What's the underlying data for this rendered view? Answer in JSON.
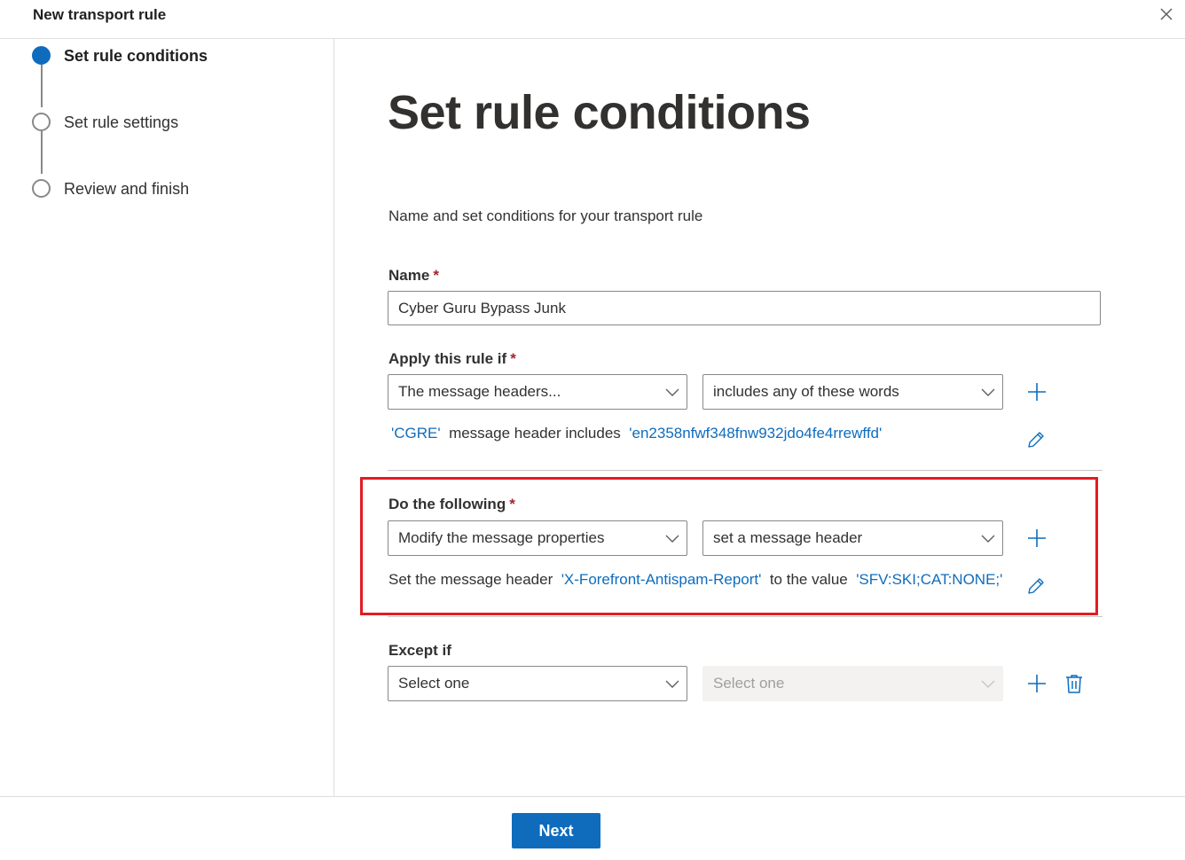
{
  "panel": {
    "title": "New transport rule"
  },
  "stepper": {
    "steps": [
      {
        "label": "Set rule conditions",
        "state": "active"
      },
      {
        "label": "Set rule settings",
        "state": "pending"
      },
      {
        "label": "Review and finish",
        "state": "pending"
      }
    ]
  },
  "main": {
    "title": "Set rule conditions",
    "subtitle": "Name and set conditions for your transport rule",
    "name": {
      "label": "Name",
      "required_mark": "*",
      "value": "Cyber Guru Bypass Junk"
    },
    "apply_if": {
      "label": "Apply this rule if",
      "required_mark": "*",
      "condition": "The message headers...",
      "operator": "includes any of these words",
      "summary": {
        "header_name": "'CGRE'",
        "middle_text": "message header includes",
        "words": "'en2358nfwf348fnw932jdo4fe4rrewffd'"
      }
    },
    "do_following": {
      "label": "Do the following",
      "required_mark": "*",
      "action": "Modify the message properties",
      "sub_action": "set a message header",
      "summary": {
        "prefix": "Set the message header",
        "header_name": "'X-Forefront-Antispam-Report'",
        "middle_text": "to the value",
        "value": "'SFV:SKI;CAT:NONE;'"
      }
    },
    "except_if": {
      "label": "Except if",
      "condition": "Select one",
      "operator": "Select one"
    }
  },
  "footer": {
    "next_label": "Next"
  },
  "colors": {
    "accent": "#0f6cbd",
    "required": "#a4262c",
    "highlight": "#e31b23"
  }
}
